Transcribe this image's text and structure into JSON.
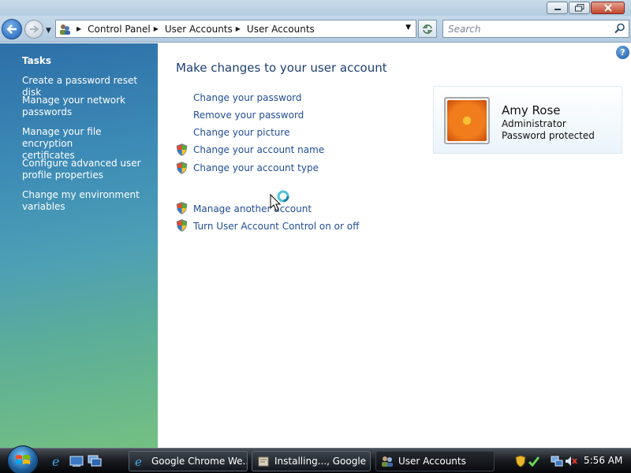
{
  "window": {
    "caption_buttons": [
      "minimize",
      "maximize",
      "close"
    ]
  },
  "nav": {
    "breadcrumbs": [
      "Control Panel",
      "User Accounts",
      "User Accounts"
    ],
    "search_placeholder": "Search"
  },
  "sidebar": {
    "title": "Tasks",
    "links": [
      {
        "line1": "Create a password reset disk",
        "line2": ""
      },
      {
        "line1": "Manage your network",
        "line2": "passwords"
      },
      {
        "line1": "Manage your file encryption",
        "line2": "certificates"
      },
      {
        "line1": "Configure advanced user",
        "line2": "profile properties"
      },
      {
        "line1": "Change my environment",
        "line2": "variables"
      }
    ]
  },
  "main": {
    "heading": "Make changes to your user account",
    "links": [
      {
        "label": "Change your password",
        "shield": false
      },
      {
        "label": "Remove your password",
        "shield": false
      },
      {
        "label": "Change your picture",
        "shield": false
      },
      {
        "label": "Change your account name",
        "shield": true
      },
      {
        "label": "Change your account type",
        "shield": true
      },
      {
        "label": "Manage another account",
        "shield": true
      },
      {
        "label": "Turn User Account Control on or off",
        "shield": true
      }
    ],
    "help_label": "?"
  },
  "user": {
    "name": "Amy Rose",
    "role": "Administrator",
    "status": "Password protected"
  },
  "taskbar": {
    "buttons": [
      {
        "label": "Google Chrome We...",
        "icon": "chrome-icon"
      },
      {
        "label": "Installing..., Google ...",
        "icon": "installer-icon"
      },
      {
        "label": "User Accounts",
        "icon": "user-accounts-icon"
      }
    ],
    "clock": "5:56 AM"
  },
  "colors": {
    "link": "#1f4e99",
    "heading": "#1d3f73",
    "taskpane_top": "#2d6fa8",
    "taskpane_bottom": "#74c082"
  }
}
